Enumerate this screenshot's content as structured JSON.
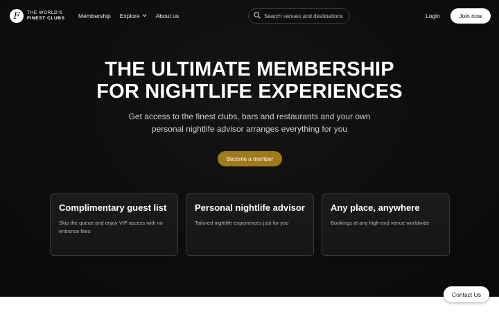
{
  "header": {
    "logo_line1": "THE WORLD'S",
    "logo_line2": "FINEST CLUBS",
    "logo_mark": "F",
    "nav": [
      {
        "label": "Membership"
      },
      {
        "label": "Explore",
        "icon": "chevron-down-icon"
      },
      {
        "label": "About us"
      }
    ],
    "search": {
      "placeholder": "Search venues and destinations",
      "icon": "search-icon"
    },
    "login_label": "Login",
    "join_label": "Join now"
  },
  "hero": {
    "title_line1": "THE ULTIMATE MEMBERSHIP",
    "title_line2": "FOR NIGHTLIFE EXPERIENCES",
    "subtitle_line1": "Get access to the finest clubs, bars and restaurants and your own",
    "subtitle_line2": "personal nightlife advisor arranges everything for you",
    "cta_label": "Become a member"
  },
  "features": [
    {
      "title": "Complimentary guest list",
      "description": "Skip the queue and enjoy VIP access with no entrance fees"
    },
    {
      "title": "Personal nightlife advisor",
      "description": "Tailored nightlife experiences just for you"
    },
    {
      "title": "Any place, anywhere",
      "description": "Bookings at any high-end venue worldwide"
    }
  ],
  "contact_label": "Contact Us",
  "colors": {
    "background": "#0d0d0d",
    "accent": "#9e7a1a",
    "card_border": "#3b3b3b"
  }
}
